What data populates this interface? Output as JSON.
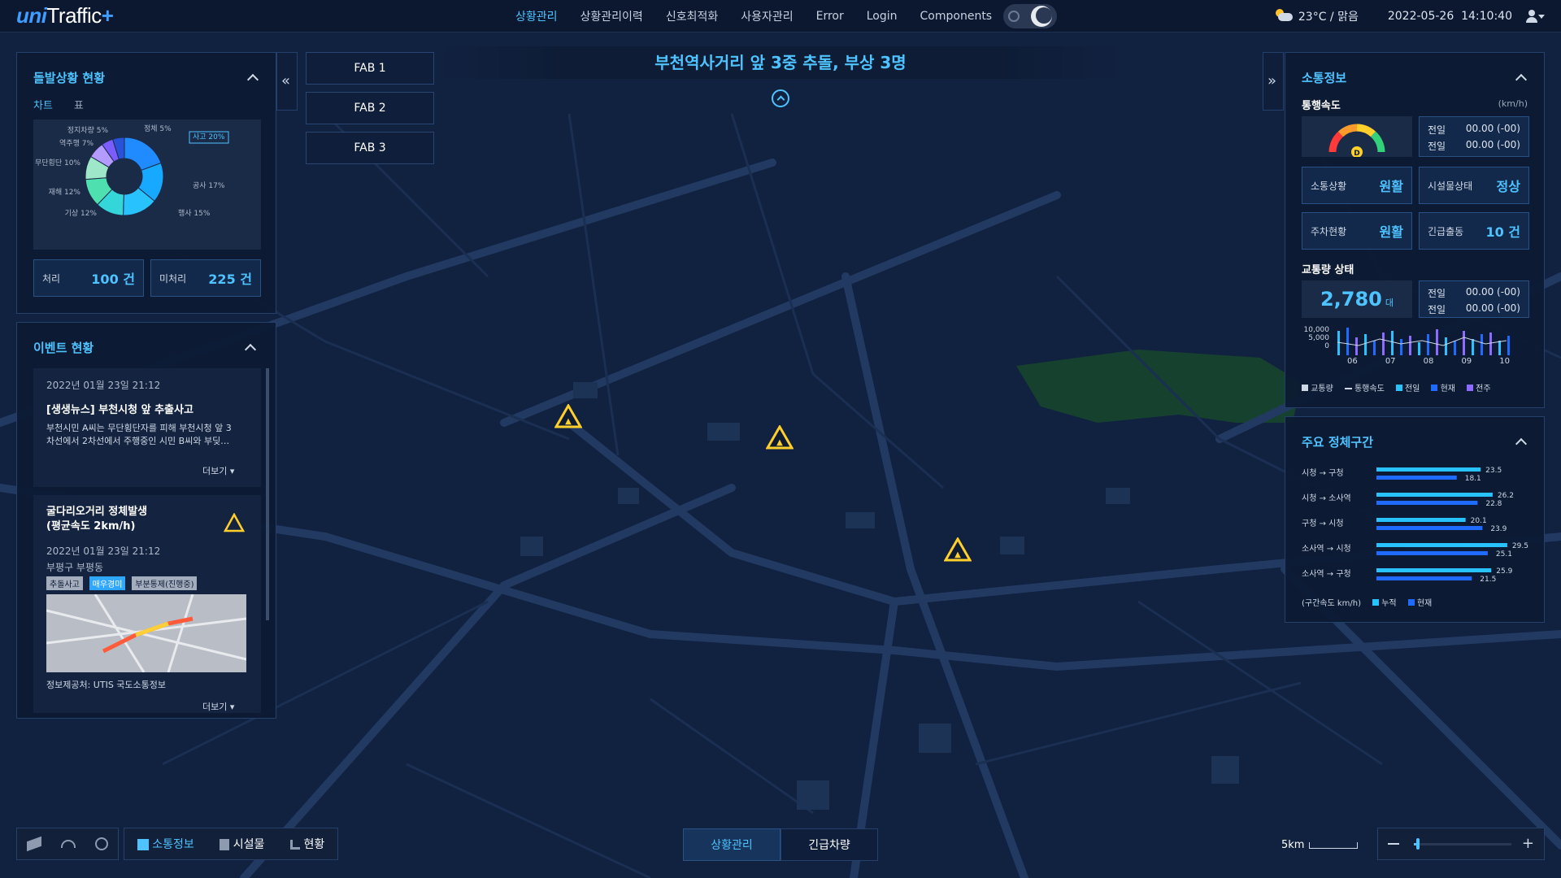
{
  "header": {
    "logo_uni": "uni",
    "logo_traffic": "Traffic",
    "logo_plus": "+",
    "nav": [
      "상황관리",
      "상황관리이력",
      "신호최적화",
      "사용자관리",
      "Error",
      "Login",
      "Components"
    ],
    "active_nav": 0,
    "weather": "23°C / 맑음",
    "datetime": "2022-05-26  14:10:40"
  },
  "left_panel": {
    "title": "돌발상황 현황",
    "tabs": [
      "차트",
      "표"
    ],
    "chart_data": {
      "type": "pie",
      "labels": [
        "사고",
        "공사",
        "행사",
        "기상",
        "재해",
        "무단횡단",
        "역주행",
        "정지차량",
        "정체"
      ],
      "values": [
        20,
        17,
        15,
        12,
        12,
        10,
        7,
        5,
        5
      ],
      "display_labels": [
        "사고 20%",
        "공사 17%",
        "행사 15%",
        "기상 12%",
        "재해 12%",
        "무단횡단 10%",
        "역주행 7%",
        "정지차량 5%",
        "정체 5%"
      ],
      "colors": [
        "#1f8bff",
        "#17a8ff",
        "#28c2ff",
        "#34d6d9",
        "#4fe0b0",
        "#9fe7c9",
        "#b49bff",
        "#7a5cff",
        "#2a52d9"
      ]
    },
    "processed_label": "처리",
    "processed_value": "100 건",
    "unprocessed_label": "미처리",
    "unprocessed_value": "225 건"
  },
  "event_panel": {
    "title": "이벤트 현황",
    "events": [
      {
        "date": "2022년 01월 23일 21:12",
        "title": "[생생뉴스] 부천시청 앞 추출사고",
        "body_line1": "부천시민 A씨는 무단횡단자를 피해 부천시청 앞 3",
        "body_line2": "차선에서 2차선에서 주행중인 시민 B씨와 부딪…",
        "more": "더보기"
      },
      {
        "title_line1": "굴다리오거리 정체발생",
        "title_line2": "(평균속도 2km/h)",
        "date": "2022년 01월 23일 21:12",
        "location": "부평구 부평동",
        "tags": [
          "추돌사고",
          "매우경미",
          "부분통제(진행중)"
        ],
        "source": "정보제공처: UTIS 국도소통정보",
        "more": "더보기"
      }
    ]
  },
  "fab": [
    "FAB 1",
    "FAB 2",
    "FAB 3"
  ],
  "alert": "부천역사거리 앞 3중 추돌, 부상 3명",
  "right_panel": {
    "title": "소통정보",
    "speed_title": "통행속도",
    "speed_unit": "(km/h)",
    "gauge_letter": "D",
    "prev_rows": [
      {
        "label": "전일",
        "value": "00.00 (-00)"
      },
      {
        "label": "전일",
        "value": "00.00 (-00)"
      }
    ],
    "status_boxes": [
      {
        "label": "소통상황",
        "value": "원활"
      },
      {
        "label": "시설물상태",
        "value": "정상"
      },
      {
        "label": "주차현황",
        "value": "원활"
      },
      {
        "label": "긴급출동",
        "value": "10 건"
      }
    ],
    "volume_title": "교통량 상태",
    "volume_value": "2,780",
    "volume_unit": "대",
    "volume_rows": [
      {
        "label": "전일",
        "value": "00.00 (-00)"
      },
      {
        "label": "전일",
        "value": "00.00 (-00)"
      }
    ],
    "volume_chart": {
      "type": "bar",
      "y_ticks": [
        "10,000",
        "5,000",
        "0"
      ],
      "x_ticks": [
        "06",
        "07",
        "08",
        "09",
        "10"
      ],
      "legend": [
        "교통량",
        "통행속도",
        "전일",
        "현재",
        "전주"
      ],
      "legend_colors": [
        "#cfd8e6",
        "#cfd8e6",
        "#28c2ff",
        "#1f6bff",
        "#8c6cff"
      ]
    }
  },
  "congestion_panel": {
    "title": "주요 정체구간",
    "chart_data": {
      "type": "bar",
      "categories": [
        "시청 → 구청",
        "시청 → 소사역",
        "구청 → 시청",
        "소사역 → 시청",
        "소사역 → 구청"
      ],
      "series": [
        {
          "name": "누적",
          "values": [
            23.5,
            26.2,
            20.1,
            29.5,
            25.9
          ]
        },
        {
          "name": "현재",
          "values": [
            18.1,
            22.8,
            23.9,
            25.1,
            21.5
          ]
        }
      ],
      "xlim": [
        0,
        33
      ]
    },
    "unit_label": "(구간속도 km/h)",
    "legend": [
      "누적",
      "현재"
    ],
    "colors": [
      "#28c2ff",
      "#1f6bff"
    ]
  },
  "bottom": {
    "tools": [
      "소통정보",
      "시설물",
      "현황"
    ],
    "center_tabs": [
      "상황관리",
      "긴급차량"
    ],
    "scale": "5km",
    "zoom_level": 0.04
  }
}
